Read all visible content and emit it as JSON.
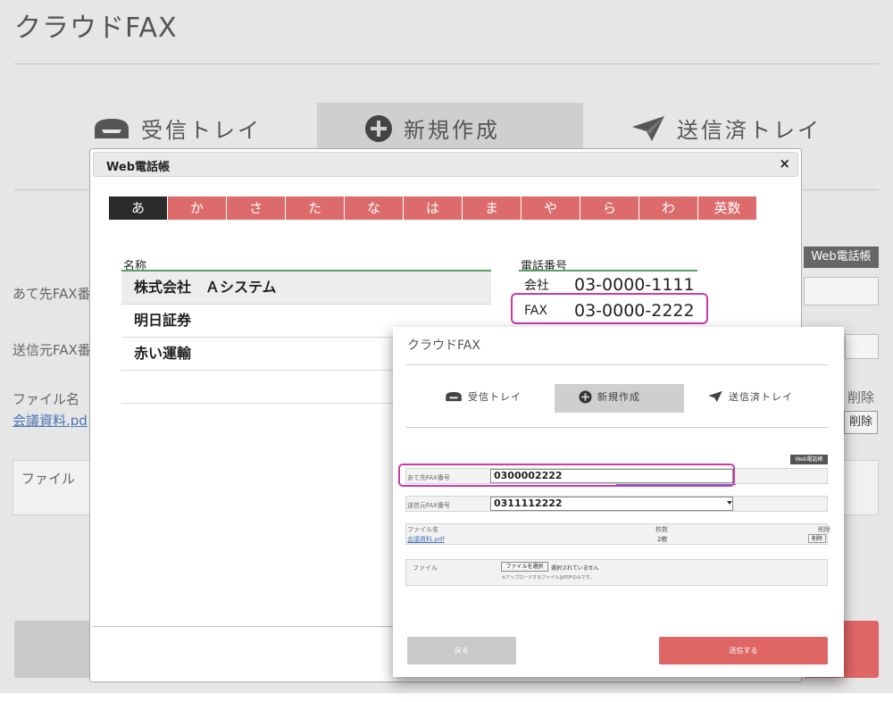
{
  "app_title": "クラウドFAX",
  "tabs": [
    {
      "label": "受信トレイ",
      "icon": "inbox-tray-icon"
    },
    {
      "label": "新規作成",
      "icon": "plus-circle-icon"
    },
    {
      "label": "送信済トレイ",
      "icon": "paper-plane-icon"
    }
  ],
  "background": {
    "webphone_button": "Web電話帳",
    "dest_fax_label": "あて先FAX番",
    "src_fax_label": "送信元FAX番",
    "file_name_label": "ファイル名",
    "file_link": "会議資料.pd",
    "delete_label": "削除",
    "delete_button": "削除",
    "file_label": "ファイル"
  },
  "dialog": {
    "title": "Web電話帳",
    "close": "×",
    "kana_tabs": [
      "あ",
      "か",
      "さ",
      "た",
      "な",
      "は",
      "ま",
      "や",
      "ら",
      "わ",
      "英数"
    ],
    "active_kana": "あ",
    "name_header": "名称",
    "phone_header": "電話番号",
    "names": [
      "株式会社　Ａシステム",
      "明日証券",
      "赤い運輸",
      ""
    ],
    "phones": [
      {
        "type": "会社",
        "number": "03-0000-1111"
      },
      {
        "type": "FAX",
        "number": "03-0000-2222"
      }
    ],
    "highlight_color": "#cc3aaa",
    "kana_color": "#dd6b6b"
  },
  "result": {
    "title": "クラウドFAX",
    "webphone_button": "Web電話帳",
    "dest_fax_label": "あて先FAX番号",
    "dest_fax_value": "0300002222",
    "src_fax_label": "送信元FAX番号",
    "src_fax_value": "0311112222",
    "file_name_header": "ファイル名",
    "page_count_header": "枚数",
    "delete_header": "削除",
    "file_link": "会議資料.pdf",
    "page_count": "2枚",
    "delete_button": "削除",
    "file_label": "ファイル",
    "choose_button": "ファイルを選択",
    "no_file_text": "選択されていません",
    "upload_note": "※アップロードするファイルはPDFのみです。",
    "back_button": "戻る",
    "send_button": "送信する",
    "send_color": "#e06666"
  }
}
